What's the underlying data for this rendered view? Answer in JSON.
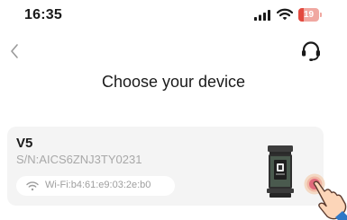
{
  "status_bar": {
    "time": "16:35",
    "battery_level": "19",
    "icons": [
      "signal-icon",
      "wifi-icon",
      "battery-icon"
    ]
  },
  "nav": {
    "back_icon": "chevron-left-icon",
    "support_icon": "headset-icon"
  },
  "page": {
    "title": "Choose your device"
  },
  "device": {
    "name": "V5",
    "serial": "S/N:AICS6ZNJ3TY0231",
    "wifi": "Wi-Fi:b4:61:e9:03:2e:b0"
  },
  "colors": {
    "card_background": "#f4f4f4",
    "secondary_text": "#a8a8a8",
    "battery_low": "#e34a3f",
    "tap_indicator": "#e06a7c"
  }
}
